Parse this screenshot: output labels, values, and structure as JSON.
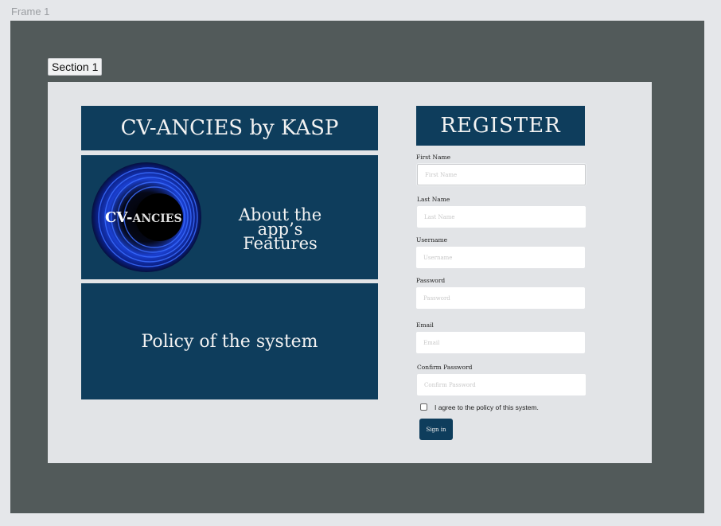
{
  "canvas": {
    "frame_label": "Frame 1",
    "section_label": "Section 1"
  },
  "left": {
    "title": "CV-ANCIES by KASP",
    "logo_text_main": "CV-",
    "logo_text_small": "ANCIES",
    "features_line1": "About the app’s",
    "features_line2": "Features",
    "policy": "Policy of the system"
  },
  "register": {
    "title": "REGISTER",
    "fields": {
      "first_name": {
        "label": "First Name",
        "placeholder": "First Name"
      },
      "last_name": {
        "label": "Last Name",
        "placeholder": "Last Name"
      },
      "username": {
        "label": "Username",
        "placeholder": "Username"
      },
      "password": {
        "label": "Password",
        "placeholder": "Password"
      },
      "email": {
        "label": "Email",
        "placeholder": "Email"
      },
      "confirm_password": {
        "label": "Confirm Password",
        "placeholder": "Confirm Password"
      }
    },
    "agree_label": "I agree to the policy of this system.",
    "agree_checked": false,
    "signin_label": "Sign in"
  },
  "colors": {
    "panel": "#0e3d5c",
    "frame": "#525a5a",
    "section": "#e2e4e7"
  }
}
